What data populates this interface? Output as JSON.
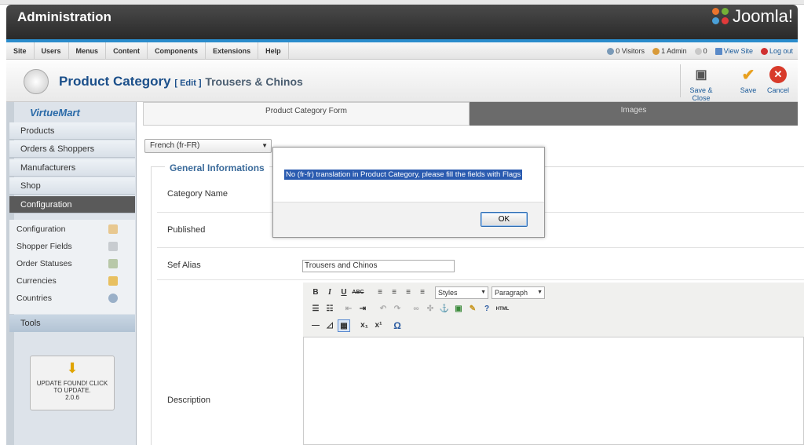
{
  "header": {
    "title": "Administration",
    "logo_text": "Joomla!"
  },
  "menu": {
    "items": [
      "Site",
      "Users",
      "Menus",
      "Content",
      "Components",
      "Extensions",
      "Help"
    ]
  },
  "status": {
    "visitors": "0 Visitors",
    "admins": "1 Admin",
    "messages": "0",
    "view_site": "View Site",
    "logout": "Log out"
  },
  "page": {
    "title": "Product Category",
    "edit": "[ Edit ]",
    "subtitle": "Trousers & Chinos"
  },
  "toolbar": {
    "save_close": "Save & Close",
    "save": "Save",
    "cancel": "Cancel"
  },
  "sidebar": {
    "logo": "VirtueMart",
    "items": [
      "Products",
      "Orders & Shoppers",
      "Manufacturers",
      "Shop",
      "Configuration"
    ],
    "active": "Configuration",
    "subitems": [
      "Configuration",
      "Shopper Fields",
      "Order Statuses",
      "Currencies",
      "Countries"
    ],
    "tools": "Tools",
    "update": {
      "line1": "UPDATE FOUND! CLICK",
      "line2": "TO UPDATE.",
      "version": "2.0.6"
    }
  },
  "tabs": {
    "form": "Product Category Form",
    "images": "Images"
  },
  "language": {
    "selected": "French (fr-FR)"
  },
  "form": {
    "legend": "General Informations",
    "category_name_label": "Category Name",
    "published_label": "Published",
    "sef_alias_label": "Sef Alias",
    "sef_alias_value": "Trousers and Chinos",
    "description_label": "Description"
  },
  "editor": {
    "styles": "Styles",
    "paragraph": "Paragraph",
    "html": "HTML"
  },
  "dialog": {
    "message": "No (fr-fr) translation in Product Category, please fill the fields with Flags",
    "ok": "OK"
  },
  "colors": {
    "header": "#2a2a2a",
    "accent": "#2a8ccc",
    "title": "#1b4f8a",
    "selection": "#2a5bb0"
  }
}
